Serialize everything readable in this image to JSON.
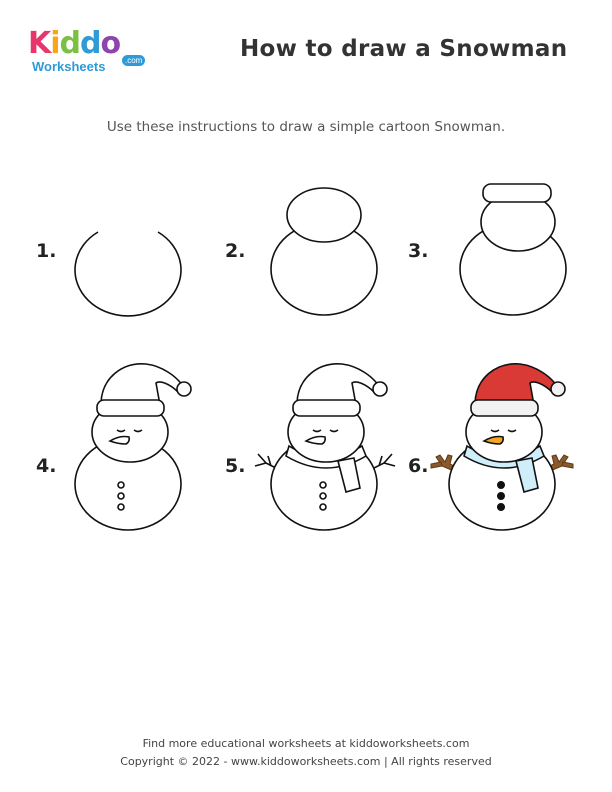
{
  "logo": {
    "letters": [
      {
        "char": "K",
        "color": "#e8356b"
      },
      {
        "char": "i",
        "color": "#f7a51c"
      },
      {
        "char": "d",
        "color": "#7bc043"
      },
      {
        "char": "d",
        "color": "#2e9bd6"
      },
      {
        "char": "o",
        "color": "#8e44ad"
      }
    ],
    "sub": "Worksheets",
    "com": ".com"
  },
  "title": "How to draw a Snowman",
  "subtitle": "Use these instructions to draw a simple cartoon Snowman.",
  "steps": [
    {
      "number": "1."
    },
    {
      "number": "2."
    },
    {
      "number": "3."
    },
    {
      "number": "4."
    },
    {
      "number": "5."
    },
    {
      "number": "6."
    }
  ],
  "colors": {
    "hat_red": "#d93a35",
    "hat_band": "#f2f2f2",
    "scarf": "#cfeefa",
    "nose": "#f5a623",
    "arms": "#8b5a2b",
    "buttons": "#111111"
  },
  "footer": {
    "line1": "Find more educational worksheets at kiddoworksheets.com",
    "line2": "Copyright © 2022 - www.kiddoworksheets.com  |  All rights reserved"
  }
}
